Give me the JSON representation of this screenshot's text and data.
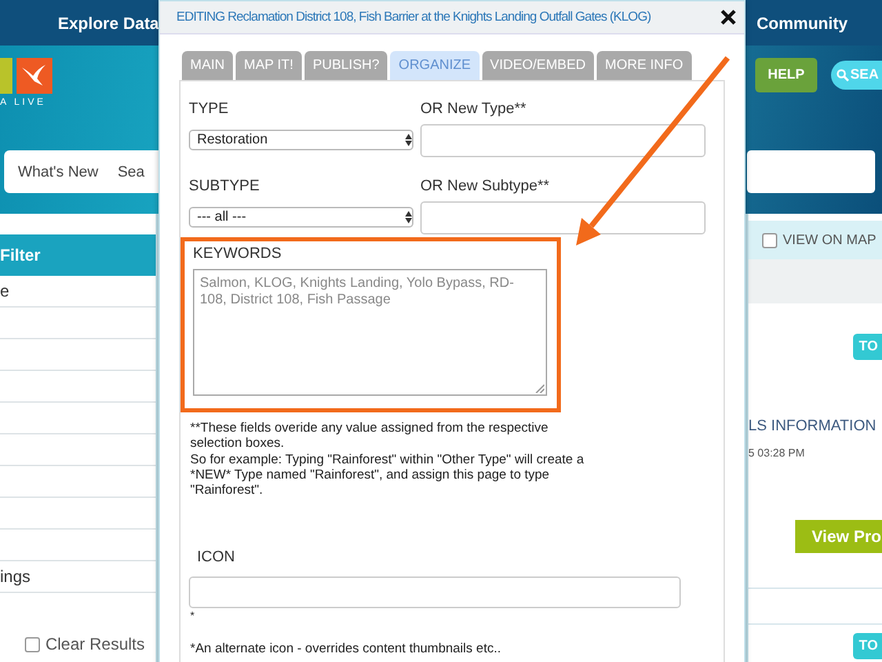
{
  "nav": {
    "items": [
      "Explore Data",
      "Community"
    ]
  },
  "banner": {
    "logo_text": "A LIVE",
    "search_tabs": [
      "What's New",
      "Sea"
    ],
    "help_button": "HELP",
    "search_button": "SEA"
  },
  "sidebar": {
    "header": "Filter",
    "rows": [
      "e",
      "ings"
    ],
    "clear_results": {
      "label": "Clear Results",
      "checked": false
    }
  },
  "results": {
    "view_on_map": {
      "label": "VIEW ON MAP",
      "checked": false
    },
    "tags": [
      "TO",
      "TO"
    ],
    "item_title": "LS INFORMATION",
    "item_date": "5 03:28 PM",
    "view_button": "View Pro"
  },
  "modal": {
    "title": "EDITING Reclamation District 108, Fish Barrier at the Knights Landing Outfall Gates (KLOG)",
    "tabs": [
      {
        "label": "MAIN",
        "selected": false
      },
      {
        "label": "MAP IT!",
        "selected": false
      },
      {
        "label": "PUBLISH?",
        "selected": false
      },
      {
        "label": "ORGANIZE",
        "selected": true
      },
      {
        "label": "VIDEO/EMBED",
        "selected": false
      },
      {
        "label": "MORE INFO",
        "selected": false
      }
    ],
    "type": {
      "label": "TYPE",
      "value": "Restoration"
    },
    "new_type": {
      "label": "OR New Type**"
    },
    "subtype": {
      "label": "SUBTYPE",
      "value": "--- all ---"
    },
    "new_subtype": {
      "label": "OR New Subtype**"
    },
    "keywords": {
      "label": "KEYWORDS",
      "placeholder": "Salmon, KLOG, Knights Landing, Yolo Bypass, RD-108, District 108, Fish Passage",
      "highlighted": true
    },
    "notes": [
      "**These fields overide any value assigned from the respective selection boxes.",
      "So for example: Typing \"Rainforest\" within \"Other Type\" will create a *NEW* Type named \"Rainforest\", and assign this page to type \"Rainforest\"."
    ],
    "icon": {
      "label": "ICON",
      "hint": "*"
    },
    "icon_note": "*An alternate icon - overrides content thumbnails etc.."
  }
}
